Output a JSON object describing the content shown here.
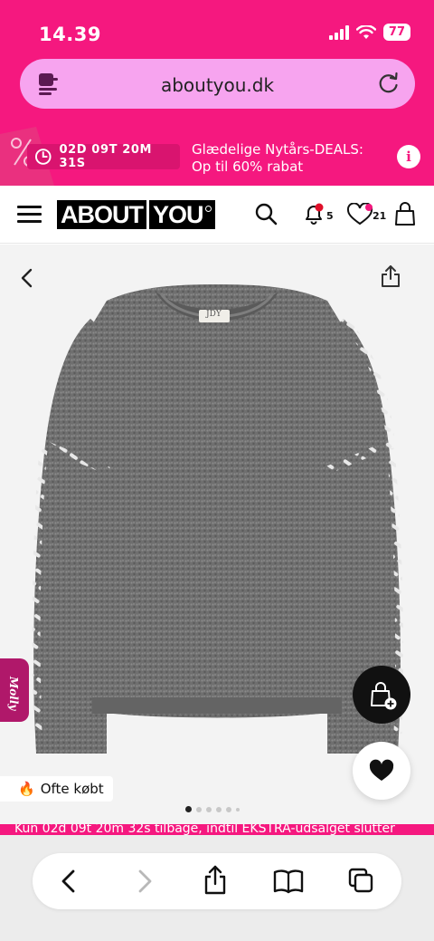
{
  "status_bar": {
    "time": "14.39",
    "battery": "77"
  },
  "browser": {
    "url": "aboutyou.dk"
  },
  "promo": {
    "countdown": "02D 09T 20M 31S",
    "message_line1": "Glædelige Nytårs-DEALS:",
    "message_line2": "Op til 60% rabat",
    "info_label": "i"
  },
  "header": {
    "logo_part1": "ABOUT",
    "logo_part2": "YOU",
    "notifications_count": "5",
    "wishlist_count": "21"
  },
  "product": {
    "tag_text": "JDY",
    "often_bought_label": "Ofte købt",
    "often_bought_emoji": "🔥",
    "assistant_label": "Molly",
    "images_total": 6,
    "images_active_index": 0
  },
  "ticker": {
    "text": "Kun 02d 09t 20m 32s tilbage, indtil EKSTRA-udsalget slutter"
  },
  "colors": {
    "brand_pink": "#f5187f",
    "url_bar": "#f7a4ef",
    "molly": "#b0186a"
  }
}
